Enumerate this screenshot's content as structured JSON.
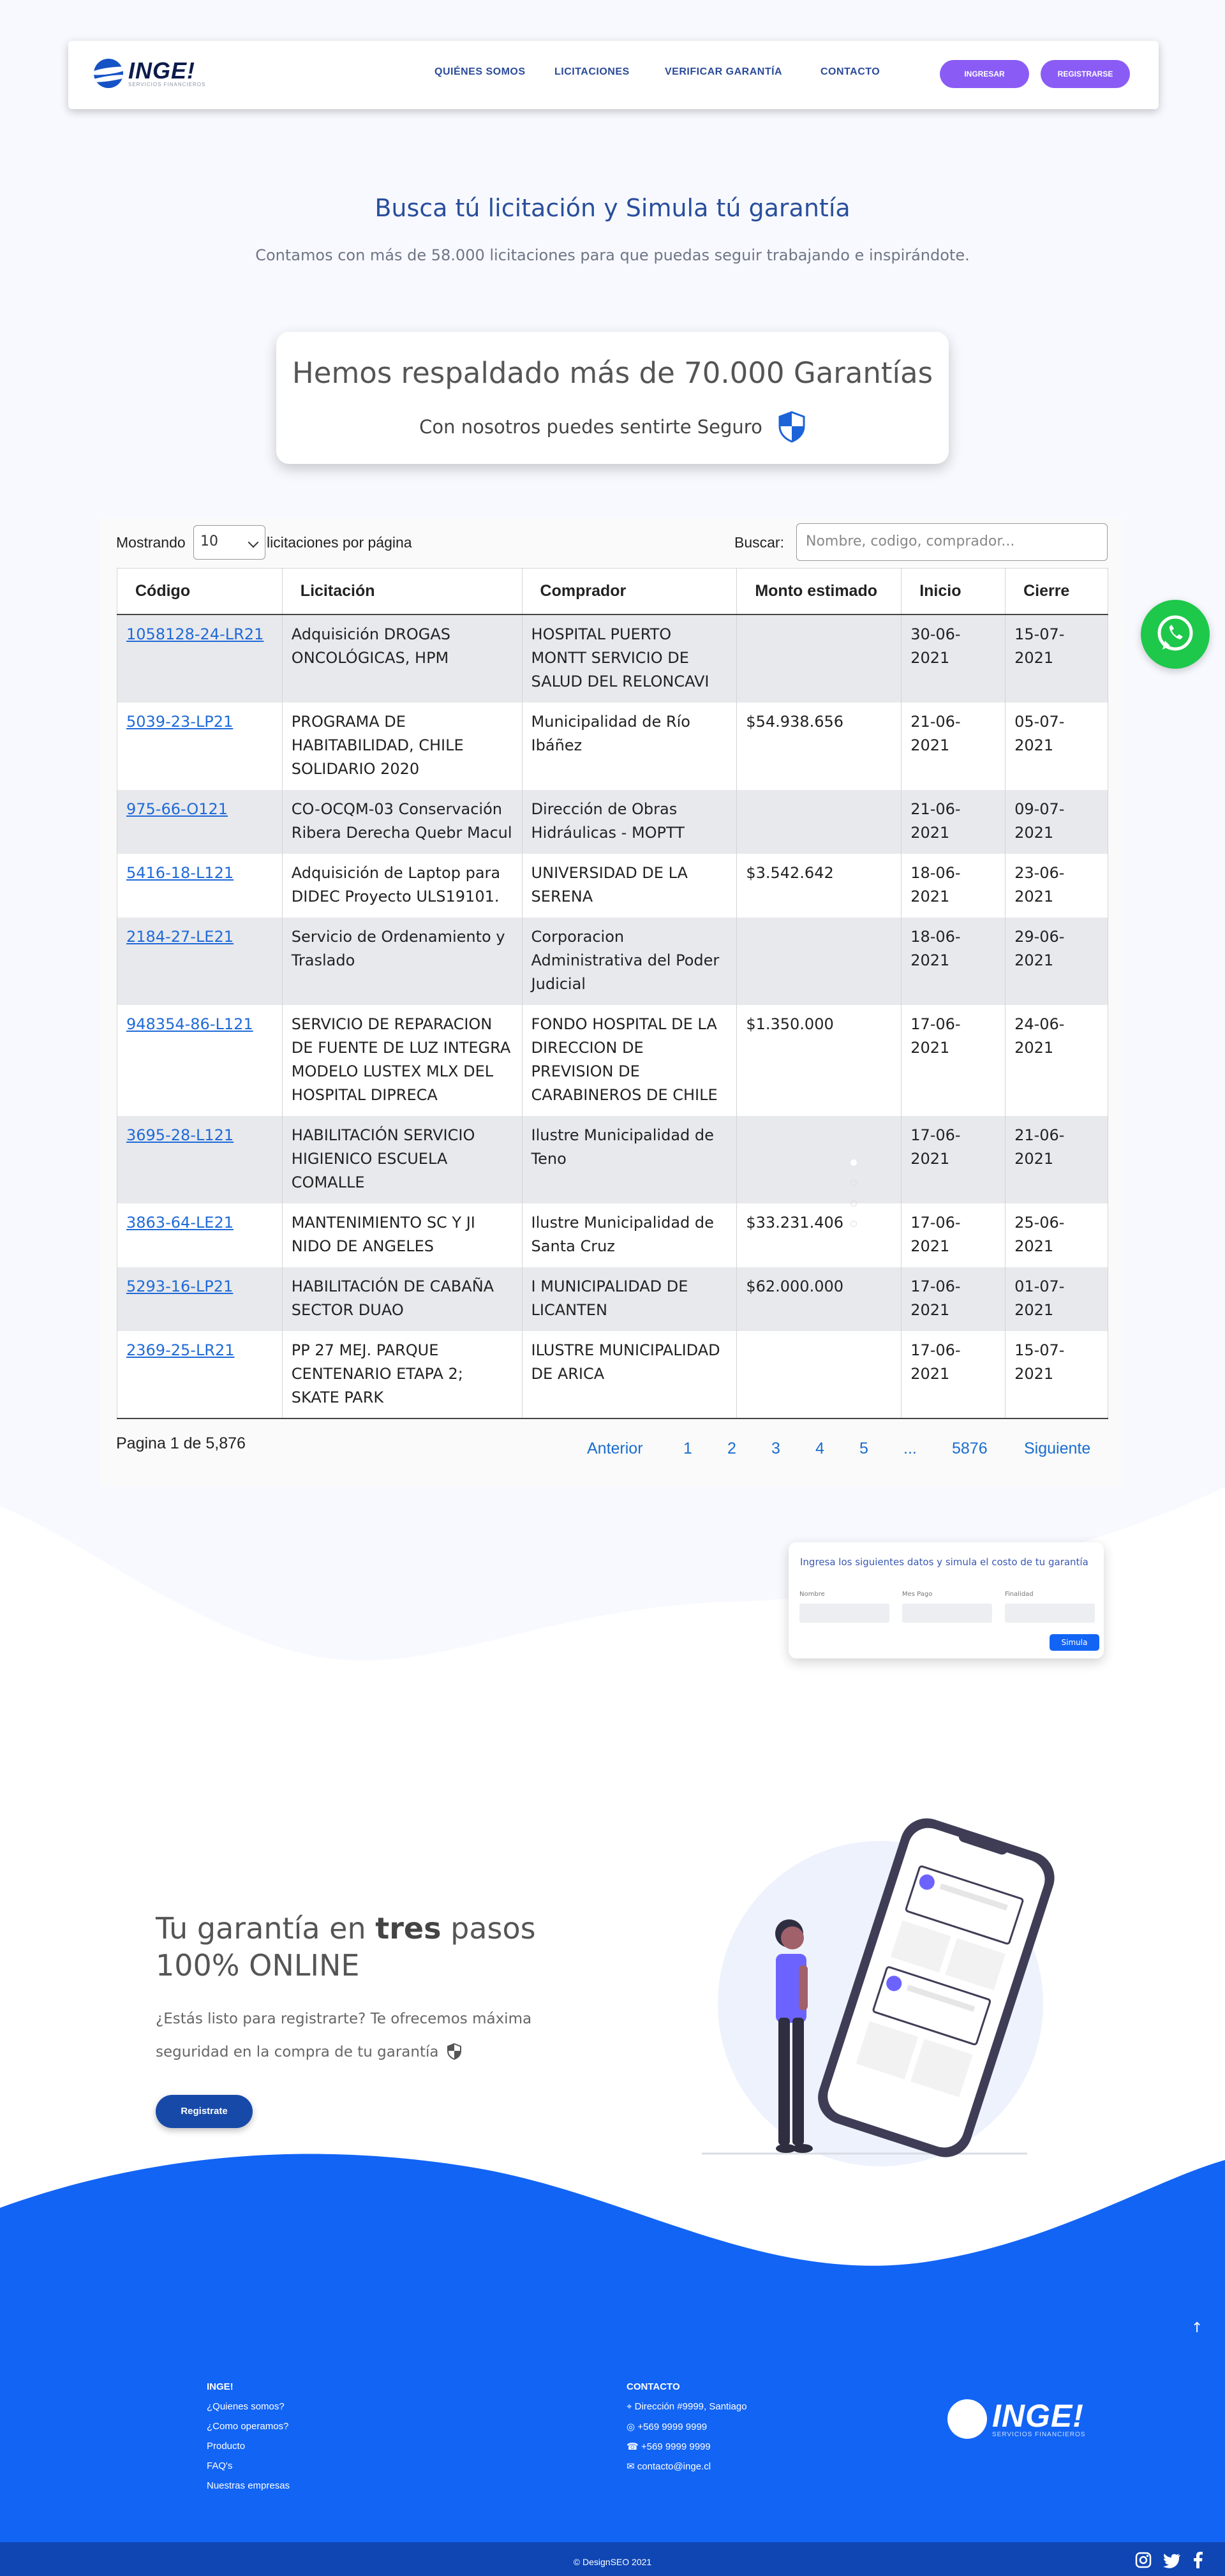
{
  "brand": {
    "name": "INGE!",
    "tagline": "SERVICIOS FINANCIEROS"
  },
  "nav": {
    "links": [
      "QUIÉNES SOMOS",
      "LICITACIONES",
      "VERIFICAR GARANTÍA",
      "CONTACTO"
    ],
    "login": "INGRESAR",
    "register": "REGISTRARSE"
  },
  "hero": {
    "title": "Busca tú licitación y Simula tú garantía",
    "subtitle": "Contamos con más de 58.000 licitaciones para que puedas seguir trabajando e inspirándote."
  },
  "card": {
    "title": "Hemos respaldado más de 70.000 Garantías",
    "subtitle": "Con nosotros puedes sentirte Seguro",
    "icon": "shield-icon"
  },
  "table": {
    "show_prefix": "Mostrando",
    "page_size": "10",
    "show_suffix": "licitaciones por página",
    "search_label": "Buscar:",
    "search_placeholder": "Nombre, codigo, comprador...",
    "columns": [
      "Código",
      "Licitación",
      "Comprador",
      "Monto estimado",
      "Inicio",
      "Cierre"
    ],
    "rows": [
      [
        "1058128-24-LR21",
        "Adquisición DROGAS ONCOLÓGICAS, HPM",
        "HOSPITAL PUERTO MONTT SERVICIO DE SALUD DEL RELONCAVI",
        "",
        "30-06-2021",
        "15-07-2021"
      ],
      [
        "5039-23-LP21",
        "PROGRAMA DE HABITABILIDAD, CHILE SOLIDARIO 2020",
        "Municipalidad de Río Ibáñez",
        "$54.938.656",
        "21-06-2021",
        "05-07-2021"
      ],
      [
        "975-66-O121",
        "CO-OCQM-03 Conservación Ribera Derecha Quebr Macul",
        "Dirección de Obras Hidráulicas - MOPTT",
        "",
        "21-06-2021",
        "09-07-2021"
      ],
      [
        "5416-18-L121",
        "Adquisición de Laptop para DIDEC Proyecto ULS19101.",
        "UNIVERSIDAD DE LA SERENA",
        "$3.542.642",
        "18-06-2021",
        "23-06-2021"
      ],
      [
        "2184-27-LE21",
        "Servicio de Ordenamiento y Traslado",
        "Corporacion Administrativa del Poder Judicial",
        "",
        "18-06-2021",
        "29-06-2021"
      ],
      [
        "948354-86-L121",
        "SERVICIO DE REPARACION DE FUENTE DE LUZ INTEGRA MODELO LUSTEX MLX DEL HOSPITAL DIPRECA",
        "FONDO HOSPITAL DE LA DIRECCION DE PREVISION DE CARABINEROS DE CHILE",
        "$1.350.000",
        "17-06-2021",
        "24-06-2021"
      ],
      [
        "3695-28-L121",
        "HABILITACIÓN SERVICIO HIGIENICO ESCUELA COMALLE",
        "Ilustre Municipalidad de Teno",
        "",
        "17-06-2021",
        "21-06-2021"
      ],
      [
        "3863-64-LE21",
        "MANTENIMIENTO SC Y JI NIDO DE ANGELES",
        "Ilustre Municipalidad de Santa Cruz",
        "$33.231.406",
        "17-06-2021",
        "25-06-2021"
      ],
      [
        "5293-16-LP21",
        "HABILITACIÓN DE CABAÑA SECTOR DUAO",
        "I MUNICIPALIDAD DE LICANTEN",
        "$62.000.000",
        "17-06-2021",
        "01-07-2021"
      ],
      [
        "2369-25-LR21",
        "PP 27 MEJ. PARQUE CENTENARIO ETAPA 2; SKATE PARK",
        "ILUSTRE MUNICIPALIDAD DE ARICA",
        "",
        "17-06-2021",
        "15-07-2021"
      ]
    ],
    "page_info": "Pagina 1 de 5,876",
    "pager": [
      "Anterior",
      "1",
      "2",
      "3",
      "4",
      "5",
      "...",
      "5876",
      "Siguiente"
    ]
  },
  "simulator": {
    "title": "Ingresa los siguientes datos y simula el costo de tu garantía",
    "fields": [
      "Nombre",
      "Mes Pago",
      "Finalidad"
    ],
    "button": "Simula"
  },
  "steps": {
    "title_a": "Tu garantía en ",
    "title_bold": "tres",
    "title_b": " pasos",
    "title_line2": "100% ONLINE",
    "desc": "¿Estás listo para registrarte? Te ofrecemos máxima seguridad en la compra de tu garantía",
    "button": "Registrate"
  },
  "footer": {
    "col1_title": "INGE!",
    "col1_links": [
      "¿Quienes somos?",
      "¿Como operamos?",
      "Producto",
      "FAQ's",
      "Nuestras empresas"
    ],
    "col2_title": "CONTACTO",
    "contacts": [
      {
        "icon": "map-pin-icon",
        "text": "Dirección #9999, Santiago"
      },
      {
        "icon": "whatsapp-icon",
        "text": "+569 9999 9999"
      },
      {
        "icon": "phone-icon",
        "text": "+569 9999 9999"
      },
      {
        "icon": "mail-icon",
        "text": "contacto@inge.cl"
      }
    ],
    "copyright": "© DesignSEO 2021"
  },
  "colors": {
    "primary": "#1264f5",
    "navy": "#0f46b3",
    "accent": "#8a5cf5",
    "whatsapp": "#25d366",
    "link": "#1f6ad8"
  }
}
